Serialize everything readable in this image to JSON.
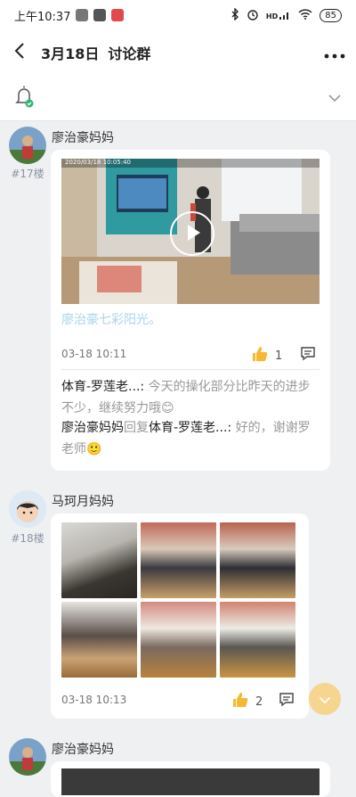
{
  "status_bar": {
    "time": "上午10:37",
    "battery": "85",
    "signal": "HD"
  },
  "nav": {
    "date": "3月18日",
    "title": "讨论群"
  },
  "posts": [
    {
      "author": "廖治豪妈妈",
      "floor": "#17楼",
      "video_timestamp": "2020/03/18 10:05:40",
      "caption": "廖治豪七彩阳光。",
      "time": "03-18 10:11",
      "likes": "1",
      "comments": [
        {
          "author": "体育-罗莲老...",
          "sep": ": ",
          "text": "今天的操化部分比昨天的进步不少，继续努力哦😊"
        },
        {
          "author": "廖治豪妈妈",
          "reply_word": "回复",
          "reply_to": "体育-罗莲老...",
          "sep": ": ",
          "text": "好的，谢谢罗老师🙂"
        }
      ]
    },
    {
      "author": "马珂月妈妈",
      "floor": "#18楼",
      "time": "03-18 10:13",
      "likes": "2"
    },
    {
      "author": "廖治豪妈妈"
    }
  ],
  "colors": {
    "accent": "#f5d58f",
    "link": "#a9d4ec",
    "floor": "#8a96a3",
    "like": "#f5b82e"
  }
}
